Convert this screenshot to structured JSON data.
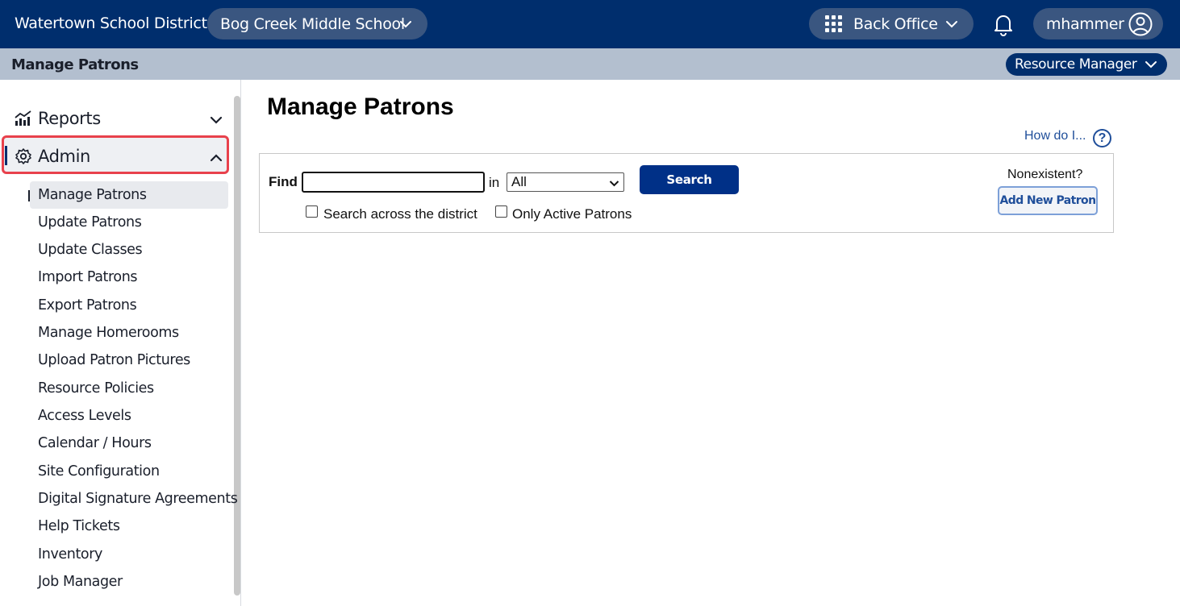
{
  "topbar": {
    "district": "Watertown School District",
    "school": "Bog Creek Middle School",
    "back_office": "Back Office",
    "user": "mhammer"
  },
  "subbar": {
    "title": "Manage Patrons",
    "resource_manager": "Resource Manager"
  },
  "sidebar": {
    "reports_label": "Reports",
    "admin_label": "Admin",
    "admin_items": [
      "Manage Patrons",
      "Update Patrons",
      "Update Classes",
      "Import Patrons",
      "Export Patrons",
      "Manage Homerooms",
      "Upload Patron Pictures",
      "Resource Policies",
      "Access Levels",
      "Calendar / Hours",
      "Site Configuration",
      "Digital Signature Agreements",
      "Help Tickets",
      "Inventory",
      "Job Manager"
    ]
  },
  "main": {
    "title": "Manage Patrons",
    "how_do_i": "How do I...",
    "help_glyph": "?",
    "find_label": "Find",
    "find_value": "",
    "in_label": "in",
    "in_selected": "All",
    "search_button": "Search",
    "search_district_label": "Search across the district",
    "only_active_label": "Only Active Patrons",
    "nonexistent": "Nonexistent?",
    "add_new_patron": "Add New Patron"
  },
  "colors": {
    "navy": "#002e6d",
    "subbar": "#b3bfcf",
    "highlight": "#e8414c",
    "link": "#1f4e9a"
  },
  "icons": [
    "grid-icon",
    "bell-icon",
    "user-icon",
    "chevron-down-icon",
    "chart-icon",
    "gear-icon",
    "chevron-up-icon",
    "help-icon"
  ]
}
